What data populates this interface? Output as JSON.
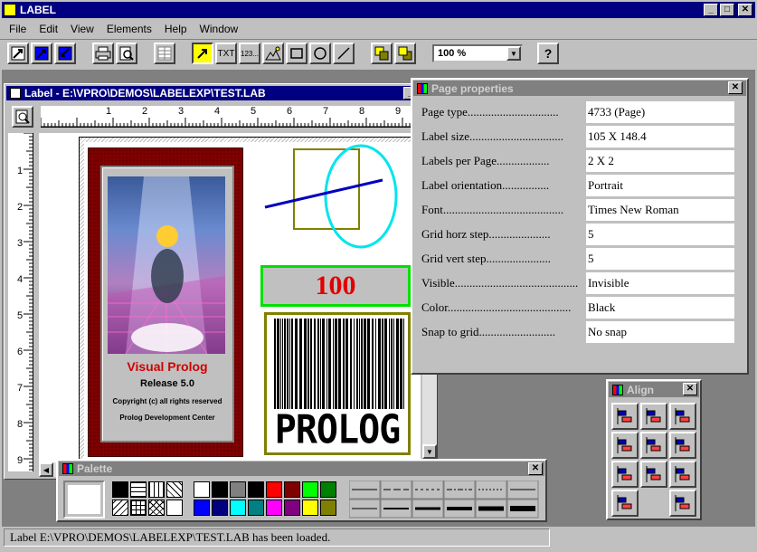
{
  "app": {
    "title": "LABEL",
    "menu": [
      "File",
      "Edit",
      "View",
      "Elements",
      "Help",
      "Window"
    ]
  },
  "toolbar": {
    "txt_label": "TXT",
    "num_label": "123...",
    "zoom_value": "100 %",
    "help_label": "?"
  },
  "doc_window": {
    "title": "Label - E:\\VPRO\\DEMOS\\LABELEXP\\TEST.LAB",
    "h_ruler": [
      "1",
      "2",
      "3",
      "4",
      "5",
      "6",
      "7",
      "8",
      "9"
    ],
    "v_ruler": [
      "1",
      "2",
      "3",
      "4",
      "5",
      "6",
      "7",
      "8",
      "9"
    ]
  },
  "label_content": {
    "product_name": "Visual Prolog",
    "release": "Release 5.0",
    "copyright": "Copyright (c) all rights reserved",
    "company": "Prolog Development Center",
    "number_field": "100",
    "barcode_text": "PROLOG"
  },
  "page_properties": {
    "title": "Page properties",
    "rows": [
      {
        "label": "Page type...............................",
        "value": "4733 (Page)"
      },
      {
        "label": "Label size................................",
        "value": "105 X 148.4"
      },
      {
        "label": "Labels per Page..................",
        "value": "2 X 2"
      },
      {
        "label": "Label orientation................",
        "value": "Portrait"
      },
      {
        "label": "Font.........................................",
        "value": "Times New Roman"
      },
      {
        "label": "Grid horz step.....................",
        "value": "5"
      },
      {
        "label": "Grid vert step......................",
        "value": "5"
      },
      {
        "label": "Visible..........................................",
        "value": "Invisible"
      },
      {
        "label": "Color..........................................",
        "value": "Black"
      },
      {
        "label": "Snap to grid..........................",
        "value": "No snap"
      }
    ]
  },
  "align_window": {
    "title": "Align"
  },
  "palette_window": {
    "title": "Palette",
    "colors": [
      "#ffffff",
      "#000000",
      "#808080",
      "#000000",
      "#ff0000",
      "#800000",
      "#00ff00",
      "#008000",
      "#0000ff",
      "#000080",
      "#00ffff",
      "#008080",
      "#ff00ff",
      "#800080",
      "#ffff00",
      "#808000"
    ]
  },
  "status": {
    "message": "Label E:\\VPRO\\DEMOS\\LABELEXP\\TEST.LAB has been loaded."
  }
}
